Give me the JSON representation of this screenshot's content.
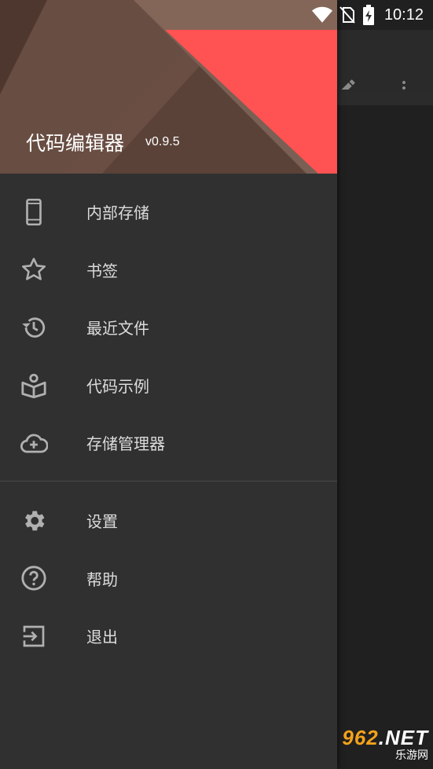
{
  "status_bar": {
    "time": "10:12",
    "icons": [
      "wifi-icon",
      "no-sim-icon",
      "battery-charging-icon"
    ]
  },
  "app_toolbar": {
    "icons": [
      "pencil-icon",
      "more-vert-icon"
    ]
  },
  "drawer": {
    "header": {
      "title": "代码编辑器",
      "version": "v0.9.5"
    },
    "items": [
      {
        "label": "内部存储",
        "icon": "phone-icon"
      },
      {
        "label": "书签",
        "icon": "star-icon"
      },
      {
        "label": "最近文件",
        "icon": "history-icon"
      },
      {
        "label": "代码示例",
        "icon": "book-icon"
      },
      {
        "label": "存储管理器",
        "icon": "cloud-add-icon"
      }
    ],
    "secondary_items": [
      {
        "label": "设置",
        "icon": "gear-icon"
      },
      {
        "label": "帮助",
        "icon": "help-icon"
      },
      {
        "label": "退出",
        "icon": "exit-icon"
      }
    ]
  },
  "watermark": {
    "top_number": "962",
    "top_suffix": ".NET",
    "bottom": "乐游网"
  },
  "colors": {
    "drawer_bg": "#303030",
    "header_brown": "#6e5448",
    "header_red": "#ff5252",
    "icon_gray": "#b0b0b0"
  }
}
